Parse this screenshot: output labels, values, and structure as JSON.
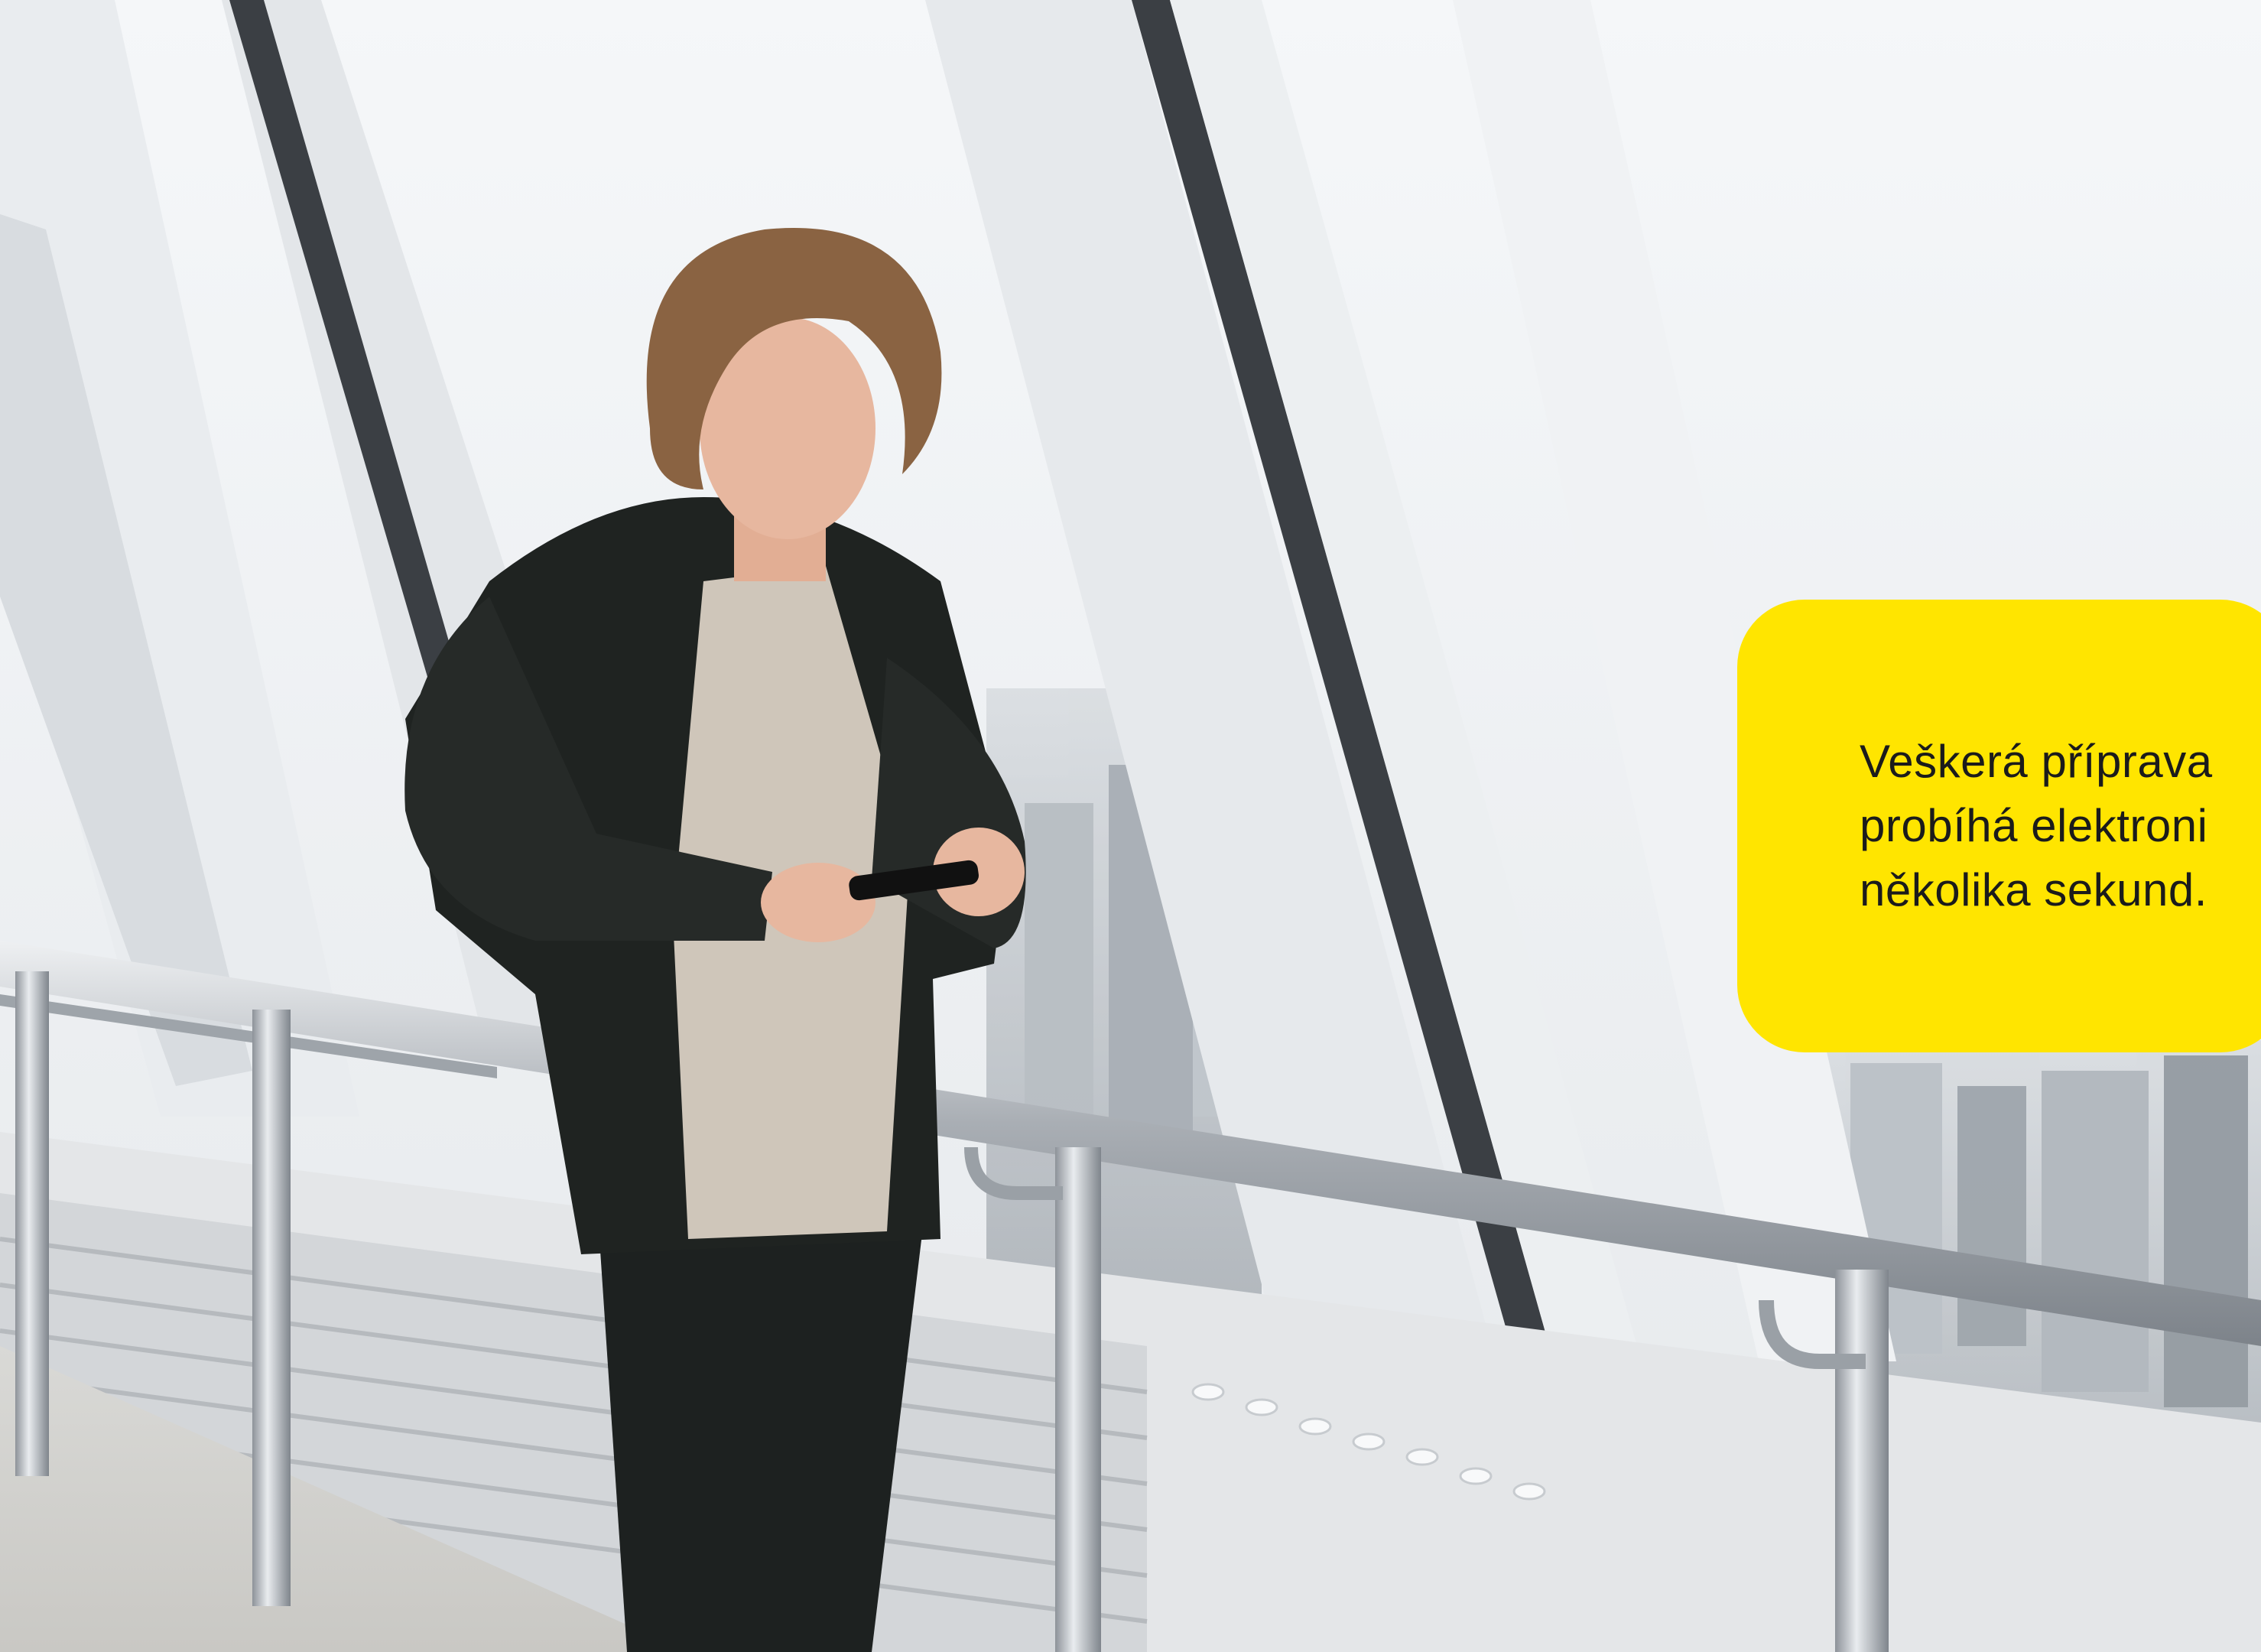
{
  "callout": {
    "lines": [
      "Veškerá příprava",
      "probíhá elektroni",
      "několika sekund."
    ],
    "background_color": "#ffe500",
    "text_color": "#1b1b1b"
  },
  "photo": {
    "palette": {
      "sky": "#f3f5f7",
      "frame": "#e7eaed",
      "mullion_dark": "#3b3f44",
      "railing": "#b9bec4",
      "jacket": "#1f2321",
      "sweater": "#cfc6ba",
      "hair": "#8a6342"
    }
  }
}
